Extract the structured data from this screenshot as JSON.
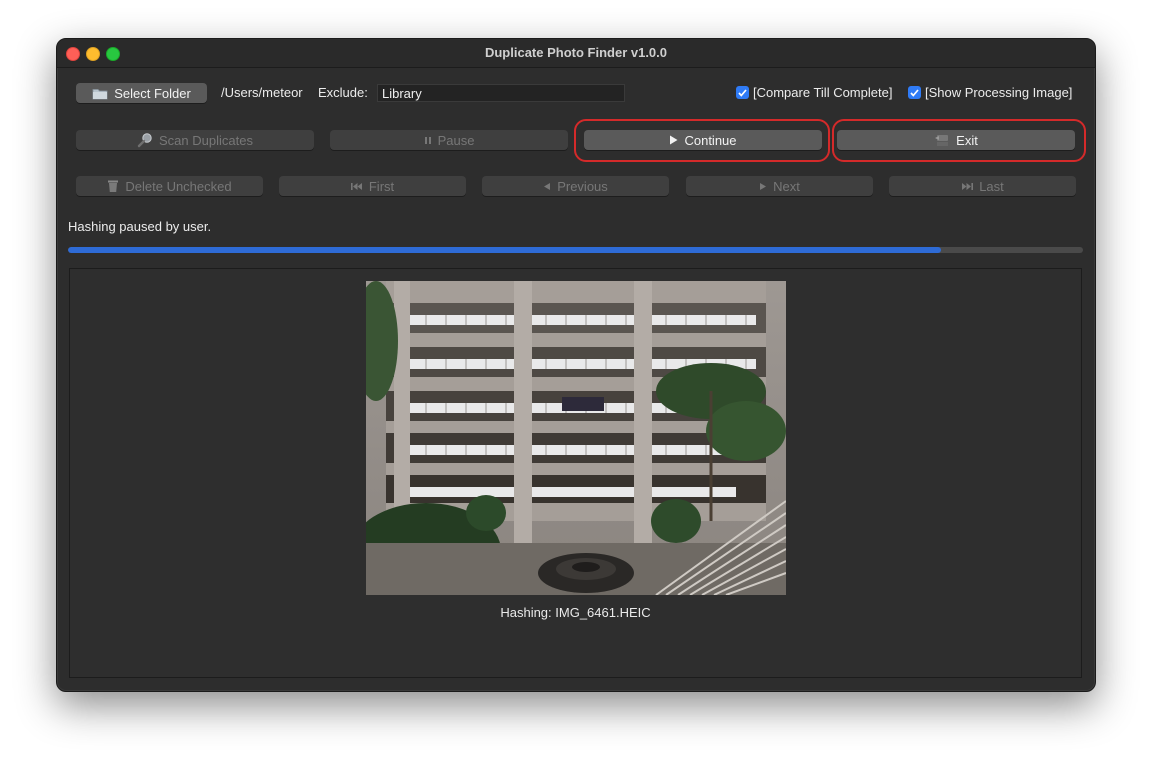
{
  "window": {
    "title": "Duplicate Photo Finder v1.0.0"
  },
  "toolbar": {
    "select_folder_label": "Select Folder",
    "folder_path": "/Users/meteor",
    "exclude_label": "Exclude:",
    "exclude_value": "Library",
    "compare_till_complete_label": "[Compare Till Complete]",
    "compare_till_complete_checked": true,
    "show_processing_image_label": "[Show Processing Image]",
    "show_processing_image_checked": true
  },
  "actions": {
    "scan_label": "Scan Duplicates",
    "pause_label": "Pause",
    "continue_label": "Continue",
    "exit_label": "Exit"
  },
  "navigation": {
    "delete_label": "Delete Unchecked",
    "first_label": "First",
    "previous_label": "Previous",
    "next_label": "Next",
    "last_label": "Last"
  },
  "status": {
    "message": "Hashing paused by user.",
    "progress_percent": 86
  },
  "preview": {
    "caption": "Hashing: IMG_6461.HEIC"
  },
  "icons": {
    "select_folder": "folder-icon",
    "scan": "magnifier-icon",
    "pause": "pause-icon",
    "continue": "play-icon",
    "exit": "exit-icon",
    "delete": "trash-icon",
    "first": "skip-first-icon",
    "previous": "previous-icon",
    "next": "next-icon",
    "last": "skip-last-icon"
  },
  "colors": {
    "accent": "#2f7bf6",
    "progress": "#2e6bd6",
    "highlight": "#d42a2a"
  }
}
